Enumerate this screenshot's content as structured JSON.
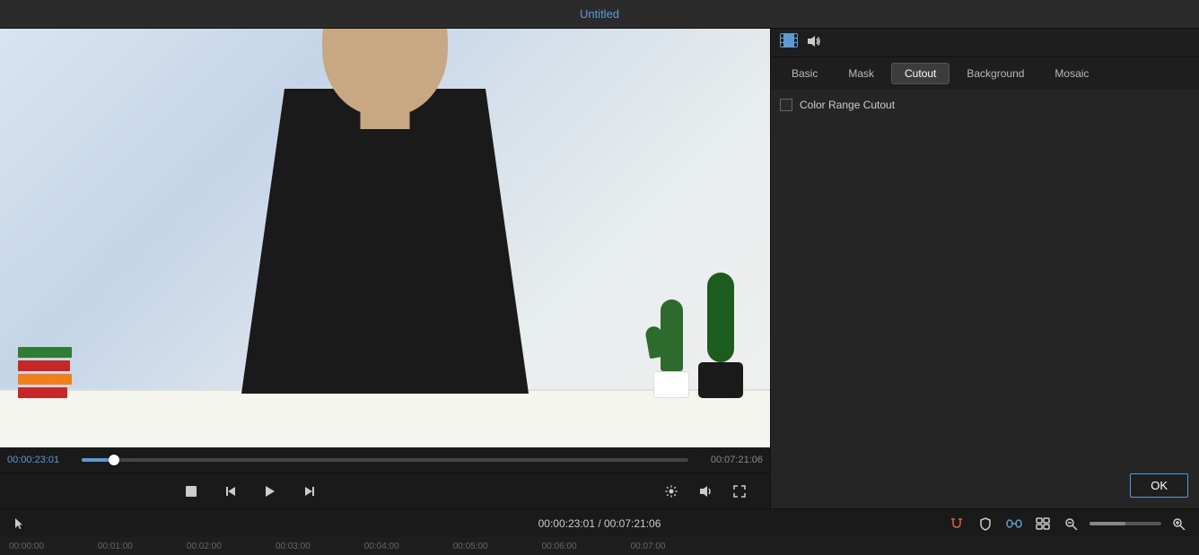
{
  "titleBar": {
    "title": "Untitled"
  },
  "videoPanel": {
    "currentTime": "00:00:23:01",
    "totalTime": "00:07:21:06",
    "statusTime": "00:00:23:01 / 00:07:21:06",
    "progressPercent": 5.3,
    "controls": {
      "stop": "■",
      "stepBack": "◄",
      "play": "►",
      "stepForward": "►►"
    }
  },
  "rightPanel": {
    "tabs": [
      {
        "id": "basic",
        "label": "Basic",
        "active": false
      },
      {
        "id": "mask",
        "label": "Mask",
        "active": false
      },
      {
        "id": "cutout",
        "label": "Cutout",
        "active": true
      },
      {
        "id": "background",
        "label": "Background",
        "active": false
      },
      {
        "id": "mosaic",
        "label": "Mosaic",
        "active": false
      }
    ],
    "cutout": {
      "colorRangeCutout": {
        "label": "Color Range Cutout",
        "checked": false
      }
    },
    "okButton": "OK"
  },
  "statusBar": {
    "centerTime": "00:00:23:01 / 00:07:21:06"
  },
  "timeline": {
    "ticks": [
      "00:00:00",
      "00:01:00",
      "00:02:00",
      "00:03:00",
      "00:04:00",
      "00:05:00",
      "00:06:00",
      "00:07:00"
    ]
  }
}
